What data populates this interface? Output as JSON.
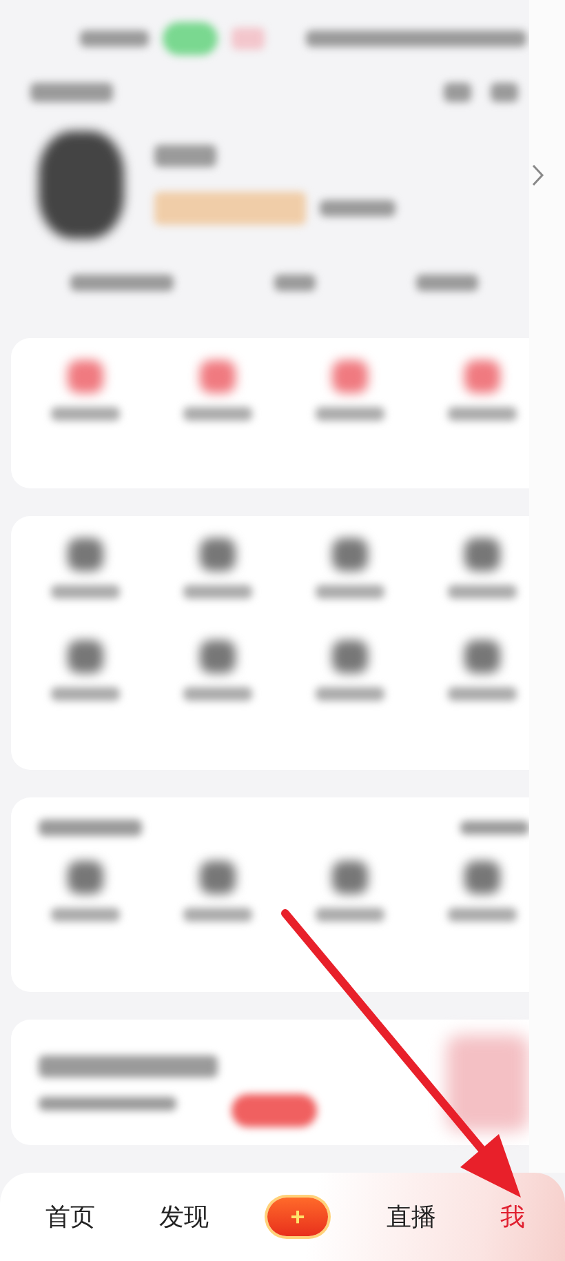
{
  "tab_bar": {
    "tabs": [
      {
        "label": "首页",
        "kind": "text",
        "selected": false
      },
      {
        "label": "发现",
        "kind": "text",
        "selected": false
      },
      {
        "label": "+",
        "kind": "plus",
        "selected": false
      },
      {
        "label": "直播",
        "kind": "text",
        "selected": false
      },
      {
        "label": "我",
        "kind": "text",
        "selected": true
      }
    ]
  }
}
